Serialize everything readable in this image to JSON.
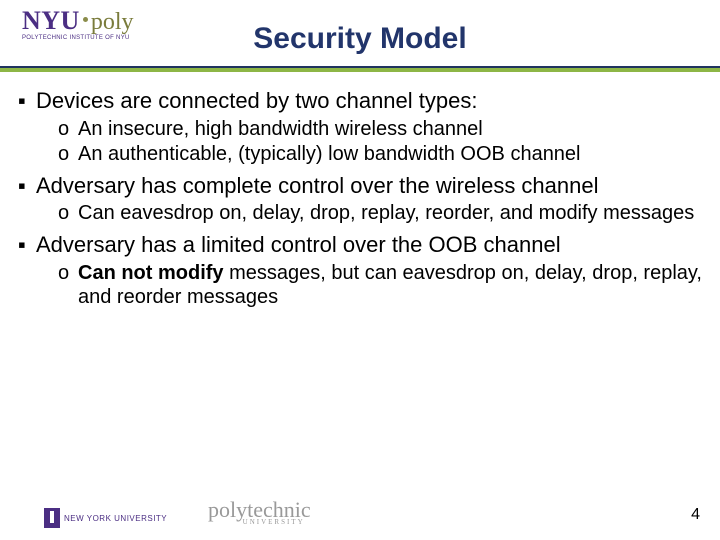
{
  "logo_top": {
    "nyu": "NYU",
    "poly": "poly",
    "sub": "POLYTECHNIC INSTITUTE OF NYU"
  },
  "title": "Security Model",
  "bullets": [
    {
      "text": "Devices are connected by two channel types:",
      "sub": [
        {
          "text": "An insecure, high bandwidth wireless channel"
        },
        {
          "text": "An authenticable, (typically) low bandwidth OOB channel"
        }
      ]
    },
    {
      "text": "Adversary has complete control over the wireless channel",
      "sub": [
        {
          "text": "Can eavesdrop on, delay, drop, replay, reorder, and modify messages"
        }
      ]
    },
    {
      "text": "Adversary has a limited control over the OOB channel",
      "sub": [
        {
          "bold_prefix": "Can not modify",
          "rest": " messages, but can eavesdrop on, delay, drop, replay, and reorder messages"
        }
      ]
    }
  ],
  "footer": {
    "nyu_label": "NEW YORK UNIVERSITY",
    "poly_big": "polytechnic",
    "poly_small": "UNIVERSITY",
    "page": "4"
  }
}
